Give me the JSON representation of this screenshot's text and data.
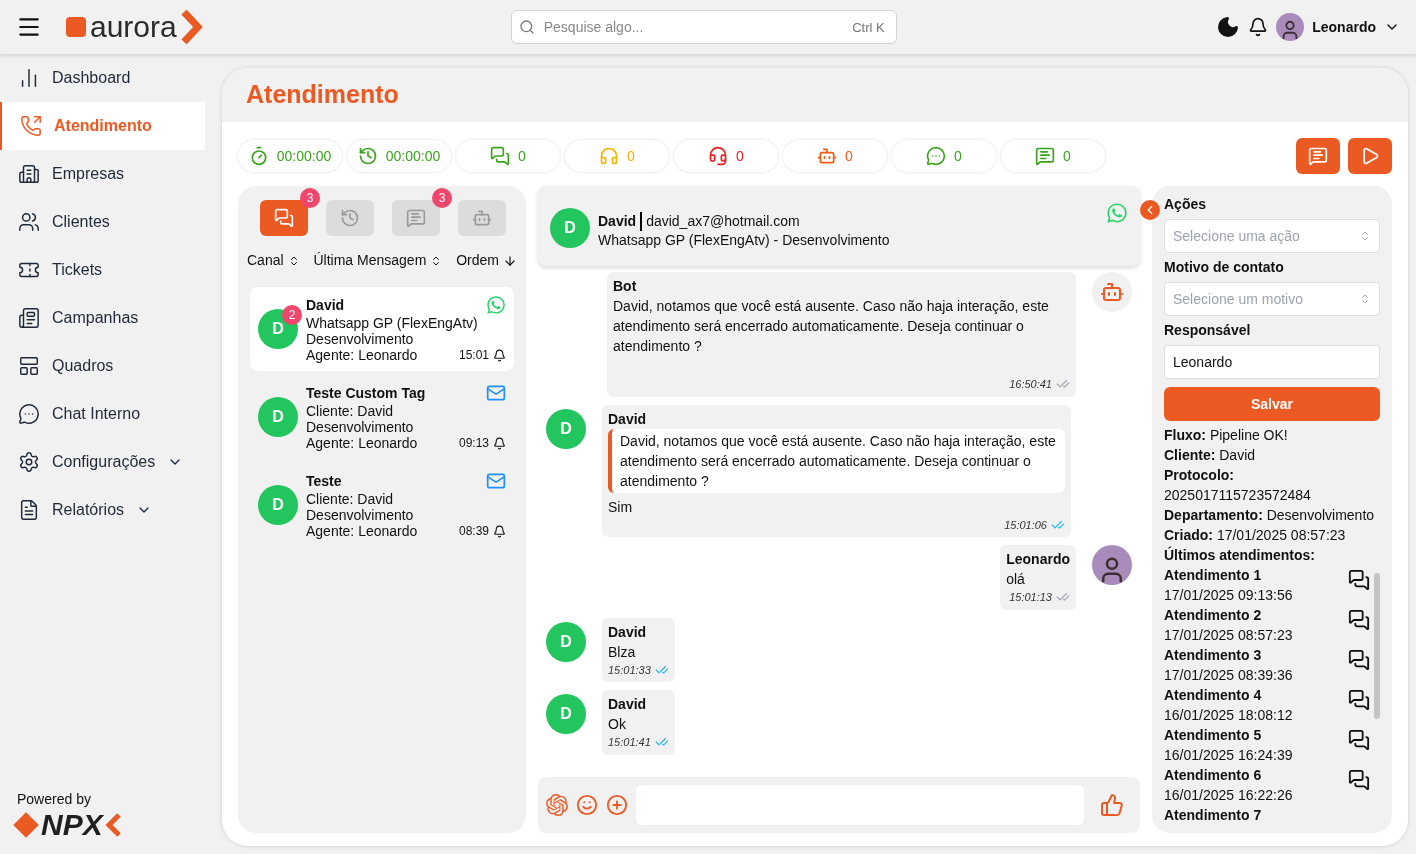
{
  "header": {
    "brand": "aurora",
    "search": {
      "placeholder": "Pesquise algo...",
      "shortcut": "Ctrl K"
    },
    "user": "Leonardo"
  },
  "sidebar": {
    "items": [
      {
        "label": "Dashboard",
        "selected": false,
        "expandable": false
      },
      {
        "label": "Atendimento",
        "selected": true,
        "expandable": false
      },
      {
        "label": "Empresas",
        "selected": false,
        "expandable": false
      },
      {
        "label": "Clientes",
        "selected": false,
        "expandable": false
      },
      {
        "label": "Tickets",
        "selected": false,
        "expandable": false
      },
      {
        "label": "Campanhas",
        "selected": false,
        "expandable": false
      },
      {
        "label": "Quadros",
        "selected": false,
        "expandable": false
      },
      {
        "label": "Chat Interno",
        "selected": false,
        "expandable": false
      },
      {
        "label": "Configurações",
        "selected": false,
        "expandable": true
      },
      {
        "label": "Relatórios",
        "selected": false,
        "expandable": true
      }
    ],
    "footer": {
      "caption": "Powered by",
      "brand": "NPX"
    }
  },
  "page": {
    "title": "Atendimento"
  },
  "stats": [
    {
      "value": "00:00:00",
      "color": "#3aa31b"
    },
    {
      "value": "00:00:00",
      "color": "#3aa31b"
    },
    {
      "value": "0",
      "color": "#3aa31b"
    },
    {
      "value": "0",
      "color": "#f5b400"
    },
    {
      "value": "0",
      "color": "#f01c1c"
    },
    {
      "value": "0",
      "color": "#f05a14"
    },
    {
      "value": "0",
      "color": "#3aa31b"
    },
    {
      "value": "0",
      "color": "#3aa31b"
    }
  ],
  "queue_tabs": [
    {
      "selected": true,
      "badge": "3"
    },
    {
      "selected": false
    },
    {
      "selected": false,
      "badge": "3"
    },
    {
      "selected": false
    }
  ],
  "sort": [
    {
      "label": "Canal",
      "kind": "toggle"
    },
    {
      "label": "Última Mensagem",
      "kind": "toggle"
    },
    {
      "label": "Ordem",
      "kind": "descending"
    }
  ],
  "tickets": [
    {
      "initial": "D",
      "name": "David",
      "lines": [
        "Whatsapp GP (FlexEngAtv)",
        "Desenvolvimento",
        "Agente: Leonardo"
      ],
      "time": "15:01",
      "kind": "whatsapp",
      "selected": true,
      "badge": "2"
    },
    {
      "initial": "D",
      "name": "Teste Custom Tag",
      "lines": [
        "Cliente: David",
        "Desenvolvimento",
        "Agente: Leonardo"
      ],
      "time": "09:13",
      "kind": "email",
      "selected": false
    },
    {
      "initial": "D",
      "name": "Teste",
      "lines": [
        "Cliente: David",
        "Desenvolvimento",
        "Agente: Leonardo"
      ],
      "time": "08:39",
      "kind": "email",
      "selected": false
    }
  ],
  "chat": {
    "initial": "D",
    "name": "David",
    "email": "david_ax7@hotmail.com",
    "subtitle": "Whatsapp GP (FlexEngAtv) - Desenvolvimento",
    "messages": [
      {
        "kind": "bot",
        "author": "Bot",
        "text": "David, notamos que você está ausente. Caso não haja interação, este atendimento será encerrado automaticamente. Deseja continuar o atendimento ?",
        "time": "16:50:41",
        "read": false
      },
      {
        "kind": "incoming",
        "initial": "D",
        "author": "David",
        "quote": "David, notamos que você está ausente. Caso não haja interação, este atendimento será encerrado automaticamente. Deseja continuar o atendimento ?",
        "text": "Sim",
        "time": "15:01:06",
        "read": true
      },
      {
        "kind": "outgoing",
        "author": "Leonardo",
        "text": "olá",
        "time": "15:01:13",
        "read": false
      },
      {
        "kind": "incoming",
        "initial": "D",
        "author": "David",
        "text": "Blza",
        "time": "15:01:33",
        "read": true
      },
      {
        "kind": "incoming",
        "initial": "D",
        "author": "David",
        "text": "Ok",
        "time": "15:01:41",
        "read": true
      }
    ]
  },
  "details": {
    "fields": [
      {
        "label": "Ações",
        "kind": "select",
        "placeholder": "Selecione uma ação"
      },
      {
        "label": "Motivo de contato",
        "kind": "select",
        "placeholder": "Selecione um motivo"
      },
      {
        "label": "Responsável",
        "kind": "input",
        "value": "Leonardo"
      }
    ],
    "save": "Salvar",
    "info": [
      "**Fluxo:** Pipeline OK!",
      "**Cliente:** David",
      "**Protocolo:** 2025017115723572484",
      "**Departamento:** Desenvolvimento",
      "**Criado:** 17/01/2025 08:57:23"
    ],
    "history_title": "Últimos atendimentos:",
    "history": [
      {
        "title": "Atendimento 1",
        "date": "17/01/2025 09:13:56"
      },
      {
        "title": "Atendimento 2",
        "date": "17/01/2025 08:57:23"
      },
      {
        "title": "Atendimento 3",
        "date": "17/01/2025 08:39:36"
      },
      {
        "title": "Atendimento 4",
        "date": "16/01/2025 18:08:12"
      },
      {
        "title": "Atendimento 5",
        "date": "16/01/2025 16:24:39"
      },
      {
        "title": "Atendimento 6",
        "date": "16/01/2025 16:22:26"
      },
      {
        "title": "Atendimento 7"
      }
    ]
  }
}
